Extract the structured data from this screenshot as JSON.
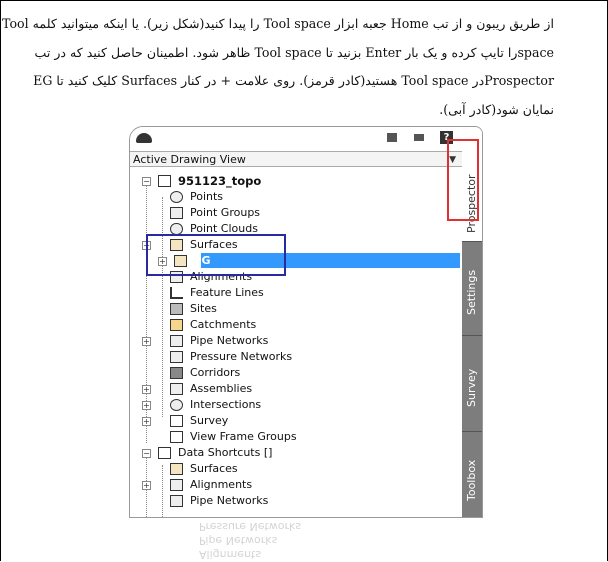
{
  "paragraph": {
    "line1": "از طریق ریبون و از تب Home جعبه ابزار Tool space را پیدا کنید(شکل زیر). یا اینکه میتوانید کلمه Tool",
    "line2": "spaceرا تایپ کرده و یک بار Enter بزنید تا Tool space ظاهر شود. اطمینان حاصل کنید که در تب",
    "line3": "Prospectorدر Tool space هستید(کادر قرمز). روی علامت + در کنار Surfaces کلیک کنید تا EG",
    "line4": "نمایان شود(کادر آبی)."
  },
  "figure": {
    "view_label": "Active Drawing View",
    "help_label": "?",
    "tabs": [
      "Prospector",
      "Settings",
      "Survey",
      "Toolbox"
    ],
    "tree": {
      "drawing": "951123_topo",
      "items": [
        "Points",
        "Point Groups",
        "Point Clouds",
        "Surfaces",
        "EG",
        "Alignments",
        "Feature Lines",
        "Sites",
        "Catchments",
        "Pipe Networks",
        "Pressure Networks",
        "Corridors",
        "Assemblies",
        "Intersections",
        "Survey",
        "View Frame Groups"
      ],
      "shortcuts_label": "Data Shortcuts []",
      "shortcut_items": [
        "Surfaces",
        "Alignments",
        "Pipe Networks",
        "Pressure Networks"
      ]
    },
    "highlight_colors": {
      "red_box": "#e03030",
      "blue_box": "#2a2aa0",
      "selection": "#3399ff"
    }
  }
}
